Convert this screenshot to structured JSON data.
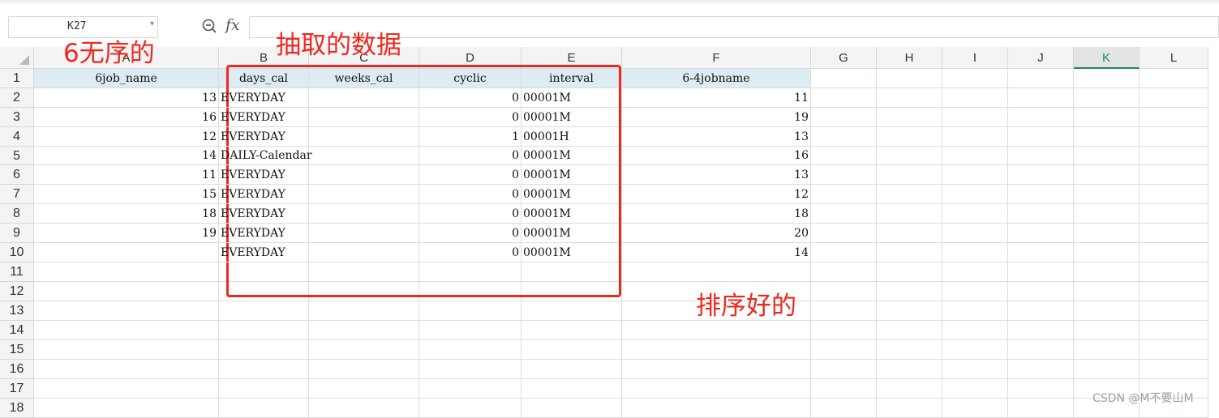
{
  "formula_bar": {
    "name_box": "K27",
    "fx_label": "fx",
    "formula": ""
  },
  "columns": [
    "A",
    "B",
    "C",
    "D",
    "E",
    "F",
    "G",
    "H",
    "I",
    "J",
    "K",
    "L"
  ],
  "active_column": "K",
  "rows": [
    "1",
    "2",
    "3",
    "4",
    "5",
    "6",
    "7",
    "8",
    "9",
    "10",
    "11",
    "12",
    "13",
    "14",
    "15",
    "16",
    "17",
    "18"
  ],
  "headers": [
    "6job_name",
    "days_cal",
    "weeks_cal",
    "cyclic",
    "interval",
    "6-4jobname"
  ],
  "data": [
    [
      "13",
      "EVERYDAY",
      "",
      "0",
      "00001M",
      "11"
    ],
    [
      "16",
      "EVERYDAY",
      "",
      "0",
      "00001M",
      "19"
    ],
    [
      "12",
      "EVERYDAY",
      "",
      "1",
      "00001H",
      "13"
    ],
    [
      "14",
      "DAILY-Calendar",
      "",
      "0",
      "00001M",
      "16"
    ],
    [
      "11",
      "EVERYDAY",
      "",
      "0",
      "00001M",
      "13"
    ],
    [
      "15",
      "EVERYDAY",
      "",
      "0",
      "00001M",
      "12"
    ],
    [
      "18",
      "EVERYDAY",
      "",
      "0",
      "00001M",
      "18"
    ],
    [
      "19",
      "EVERYDAY",
      "",
      "0",
      "00001M",
      "20"
    ],
    [
      "",
      "EVERYDAY",
      "",
      "0",
      "00001M",
      "14"
    ]
  ],
  "annotations": {
    "unsorted": "6无序的",
    "extracted": "抽取的数据",
    "sorted": "排序好的"
  },
  "colors": {
    "annotation": "#f0271c",
    "header_fill": "#dcecf2",
    "active_accent": "#1e8a4a"
  },
  "watermark": "CSDN @M不要山M"
}
